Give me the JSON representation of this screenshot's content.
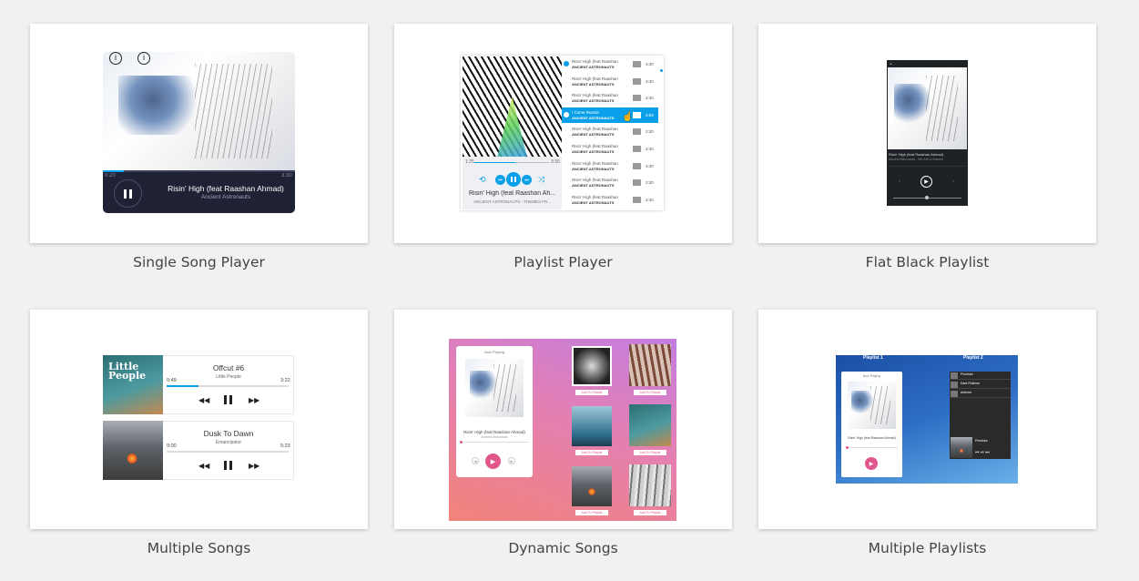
{
  "cards": [
    {
      "caption": "Single Song Player",
      "preview": {
        "elapsed": "0:20",
        "total": "3:30",
        "title": "Risin' High (feat Raashan Ahmad)",
        "artist": "Ancient Astronauts",
        "progress": 0.11
      }
    },
    {
      "caption": "Playlist Player",
      "preview": {
        "elapsed": "1:25",
        "total": "3:30",
        "now_title": "Risin' High (feat Raashan Ah...",
        "now_subtitle": "ANCIENT ASTRONAUTS - THEMES FR...",
        "progress": 0.55,
        "tracks": [
          {
            "title": "Risin' High (feat Raashan",
            "artist": "ANCIENT ASTRONAUTS",
            "time": "3:30"
          },
          {
            "title": "Risin' High (feat Raashan",
            "artist": "ANCIENT ASTRONAUTS",
            "time": "3:30"
          },
          {
            "title": "Risin' High (feat Raashan",
            "artist": "ANCIENT ASTRONAUTS",
            "time": "3:30"
          },
          {
            "title": "I Came Runnin",
            "artist": "ANCIENT ASTRONAUTS",
            "time": "3:59"
          },
          {
            "title": "Risin' High (feat Raashan",
            "artist": "ANCIENT ASTRONAUTS",
            "time": "3:30"
          },
          {
            "title": "Risin' High (feat Raashan",
            "artist": "ANCIENT ASTRONAUTS",
            "time": "3:30"
          },
          {
            "title": "Risin' High (feat Raashan",
            "artist": "ANCIENT ASTRONAUTS",
            "time": "3:30"
          },
          {
            "title": "Risin' High (feat Raashan",
            "artist": "ANCIENT ASTRONAUTS",
            "time": "3:30"
          },
          {
            "title": "Risin' High (feat Raashan",
            "artist": "ANCIENT ASTRONAUTS",
            "time": "3:30"
          }
        ]
      }
    },
    {
      "caption": "Flat Black Playlist",
      "preview": {
        "title": "Risin' High (feat Raashan Ahmad)",
        "subtitle": "Ancient Astronauts - We Are to Answer"
      }
    },
    {
      "caption": "Multiple Songs",
      "preview": {
        "songs": [
          {
            "title": "Offcut #6",
            "artist": "Little People",
            "elapsed": "0:49",
            "total": "3:22",
            "progress": 0.26
          },
          {
            "title": "Dusk To Dawn",
            "artist": "Emancipator",
            "elapsed": "0:00",
            "total": "5:23",
            "progress": 0.0
          }
        ]
      }
    },
    {
      "caption": "Dynamic Songs",
      "preview": {
        "header": "Now Playing",
        "title": "Risin' High (feat Raashan Ahmad)",
        "artist": "Ancient Astronauts",
        "add_label": "Add To Playlist"
      }
    },
    {
      "caption": "Multiple Playlists",
      "preview": {
        "playlist1": "Playlist 1",
        "playlist2": "Playlist 2",
        "header": "Now Playing",
        "title": "Risin' High (feat Raashan Ahmad)",
        "tracks": [
          "Precision",
          "Dark Rollover",
          "Anthem"
        ],
        "now_title": "Precision"
      }
    }
  ],
  "colors": {
    "accent_blue": "#0aa0e9",
    "navy": "#1f2235",
    "pink": "#e0578b"
  }
}
